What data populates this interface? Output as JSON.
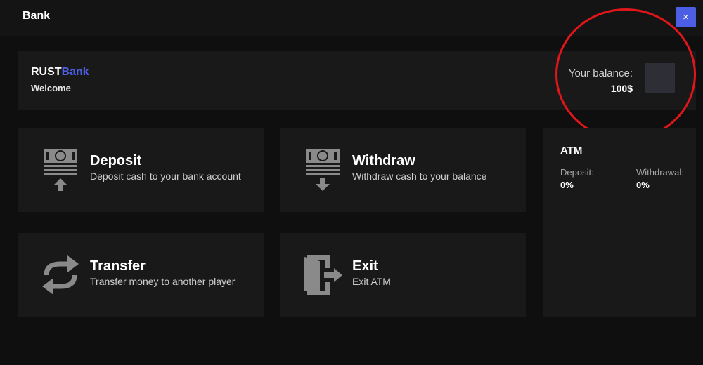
{
  "window": {
    "title": "Bank",
    "close_label": "×"
  },
  "header": {
    "brand_rust": "RUST",
    "brand_bank": "Bank",
    "welcome": "Welcome",
    "balance_label": "Your balance:",
    "balance_value": "100$"
  },
  "actions": [
    {
      "name": "Deposit",
      "desc": "Deposit cash to your bank account",
      "icon": "deposit-icon"
    },
    {
      "name": "Withdraw",
      "desc": "Withdraw cash to your balance",
      "icon": "withdraw-icon"
    },
    {
      "name": "Transfer",
      "desc": "Transfer money to another player",
      "icon": "transfer-icon"
    },
    {
      "name": "Exit",
      "desc": "Exit ATM",
      "icon": "exit-icon"
    }
  ],
  "atm": {
    "title": "ATM",
    "deposit_label": "Deposit:",
    "deposit_value": "0%",
    "withdrawal_label": "Withdrawal:",
    "withdrawal_value": "0%"
  },
  "colors": {
    "accent": "#4b5ee4",
    "annotation": "#e0161b",
    "panel": "#191919",
    "background": "#0f0f0f"
  }
}
